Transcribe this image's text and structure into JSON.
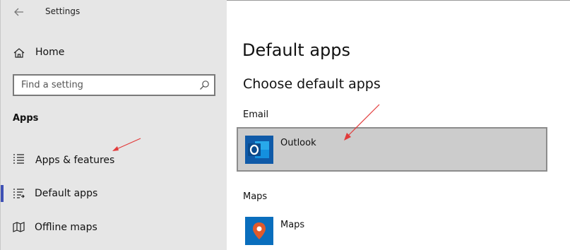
{
  "window": {
    "title": "Settings"
  },
  "sidebar": {
    "home_label": "Home",
    "search_placeholder": "Find a setting",
    "section_title": "Apps",
    "items": [
      {
        "label": "Apps & features",
        "icon": "list-icon"
      },
      {
        "label": "Default apps",
        "icon": "default-apps-icon",
        "selected": true
      },
      {
        "label": "Offline maps",
        "icon": "map-icon"
      }
    ]
  },
  "main": {
    "page_title": "Default apps",
    "subtitle": "Choose default apps",
    "categories": [
      {
        "label": "Email",
        "app": {
          "name": "Outlook",
          "icon": "outlook-icon",
          "color": "#0f5aa8"
        }
      },
      {
        "label": "Maps",
        "app": {
          "name": "Maps",
          "icon": "maps-icon",
          "color": "#0a6ebd"
        }
      }
    ]
  },
  "colors": {
    "accent": "#3f51b5",
    "annotation": "#e23b3b",
    "sidebar_bg": "#e6e6e6",
    "tile_bg": "#cccccc"
  }
}
